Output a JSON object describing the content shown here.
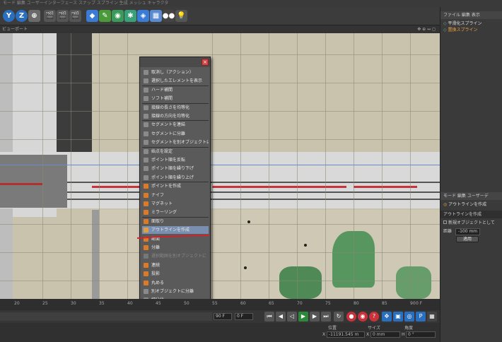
{
  "menubar": {
    "text": "モード  編集  ユーザーインターフェース  スナップ  スプライン  生成  メッシュ  キャラクタ"
  },
  "toolbar": {
    "y_label": "Y",
    "z_label": "Z"
  },
  "viewport": {
    "header_label": "ビューポート",
    "header_right": "✥ ⊕ ↔ ◻"
  },
  "right_panel": {
    "top_tabs": "ファイル  編集  表示",
    "objects": [
      "平滑化スプライン",
      "置換スプライン"
    ],
    "attr_tabs": "モード  編集  ユーザーデ",
    "tool_name": "アウトラインを作成",
    "section": "アウトラインを作成",
    "option_label": "新規オブジェクトとして",
    "distance_label": "距離",
    "distance_value": "-100 mm",
    "apply_label": "適用"
  },
  "menu": {
    "items": [
      {
        "label": "取消し（アクション）",
        "icon": "undo-icon",
        "color": "#8a8a8a"
      },
      {
        "label": "選択したエレメントを表示",
        "icon": "frame-icon",
        "color": "#8a8a8a"
      },
      {
        "label": "ハード補間",
        "icon": "hard-interp-icon",
        "color": "#8a8a8a"
      },
      {
        "label": "ソフト補間",
        "icon": "soft-interp-icon",
        "color": "#8a8a8a"
      },
      {
        "label": "接線の長さを均等化",
        "icon": "tangent-length-icon",
        "color": "#8a8a8a"
      },
      {
        "label": "接線の方向を均等化",
        "icon": "tangent-direction-icon",
        "color": "#8a8a8a"
      },
      {
        "label": "セグメントを連結",
        "icon": "join-segment-icon",
        "color": "#8a8a8a"
      },
      {
        "label": "セグメントに分離",
        "icon": "break-segment-icon",
        "color": "#8a8a8a"
      },
      {
        "label": "セグメントを別オブジェクトに",
        "icon": "explode-segments-icon",
        "color": "#8a8a8a"
      },
      {
        "label": "始点を設定",
        "icon": "set-first-point-icon",
        "color": "#8a8a8a"
      },
      {
        "label": "ポイント順を反転",
        "icon": "reverse-sequence-icon",
        "color": "#8a8a8a"
      },
      {
        "label": "ポイント順を繰り下げ",
        "icon": "move-down-icon",
        "color": "#8a8a8a"
      },
      {
        "label": "ポイント順を繰り上げ",
        "icon": "move-up-icon",
        "color": "#8a8a8a"
      },
      {
        "label": "ポイントを作成",
        "icon": "create-point-icon",
        "color": "#d97b2b"
      },
      {
        "label": "ナイフ",
        "icon": "knife-icon",
        "color": "#d97b2b"
      },
      {
        "label": "マグネット",
        "icon": "magnet-icon",
        "color": "#d97b2b"
      },
      {
        "label": "ミラーリング",
        "icon": "mirror-icon",
        "color": "#d97b2b"
      },
      {
        "label": "面取り",
        "icon": "chamfer-icon",
        "color": "#d97b2b"
      },
      {
        "label": "アウトラインを作成",
        "icon": "create-outline-icon",
        "color": "#e0a040",
        "selected": true
      },
      {
        "label": "断面",
        "icon": "cross-section-icon",
        "color": "#d97b2b"
      },
      {
        "label": "分離",
        "icon": "split-icon",
        "color": "#d97b2b"
      },
      {
        "label": "選択範囲を別オブジェクトに",
        "icon": "disconnect-icon",
        "color": "#777",
        "disabled": true
      },
      {
        "label": "連続",
        "icon": "line-up-icon",
        "color": "#d97b2b"
      },
      {
        "label": "投影",
        "icon": "project-icon",
        "color": "#d97b2b"
      },
      {
        "label": "丸める",
        "icon": "round-icon",
        "color": "#d97b2b"
      },
      {
        "label": "別オブジェクトに分離",
        "icon": "split-object-icon",
        "color": "#8a8a8a"
      },
      {
        "label": "細分化",
        "icon": "subdivide-icon",
        "color": "#8a8a8a"
      }
    ]
  },
  "timeline": {
    "ticks": [
      "20",
      "25",
      "30",
      "35",
      "40",
      "45",
      "50",
      "55",
      "60",
      "65",
      "70",
      "75",
      "80",
      "85",
      "90"
    ],
    "end_frame": "0 F",
    "current_frame": "90 F",
    "start_frame": "0 F"
  },
  "coords": {
    "headers": [
      "位置",
      "サイズ",
      "角度"
    ],
    "x_label": "X",
    "x_value": "-11191.545 m",
    "size_x_label": "X",
    "size_x_value": "0 mm",
    "angle_label": "H",
    "angle_value": "0 °"
  },
  "colors": {
    "accent_red": "#d2232a",
    "selection": "#7a8fb0",
    "icon_orange": "#d97b2b"
  }
}
